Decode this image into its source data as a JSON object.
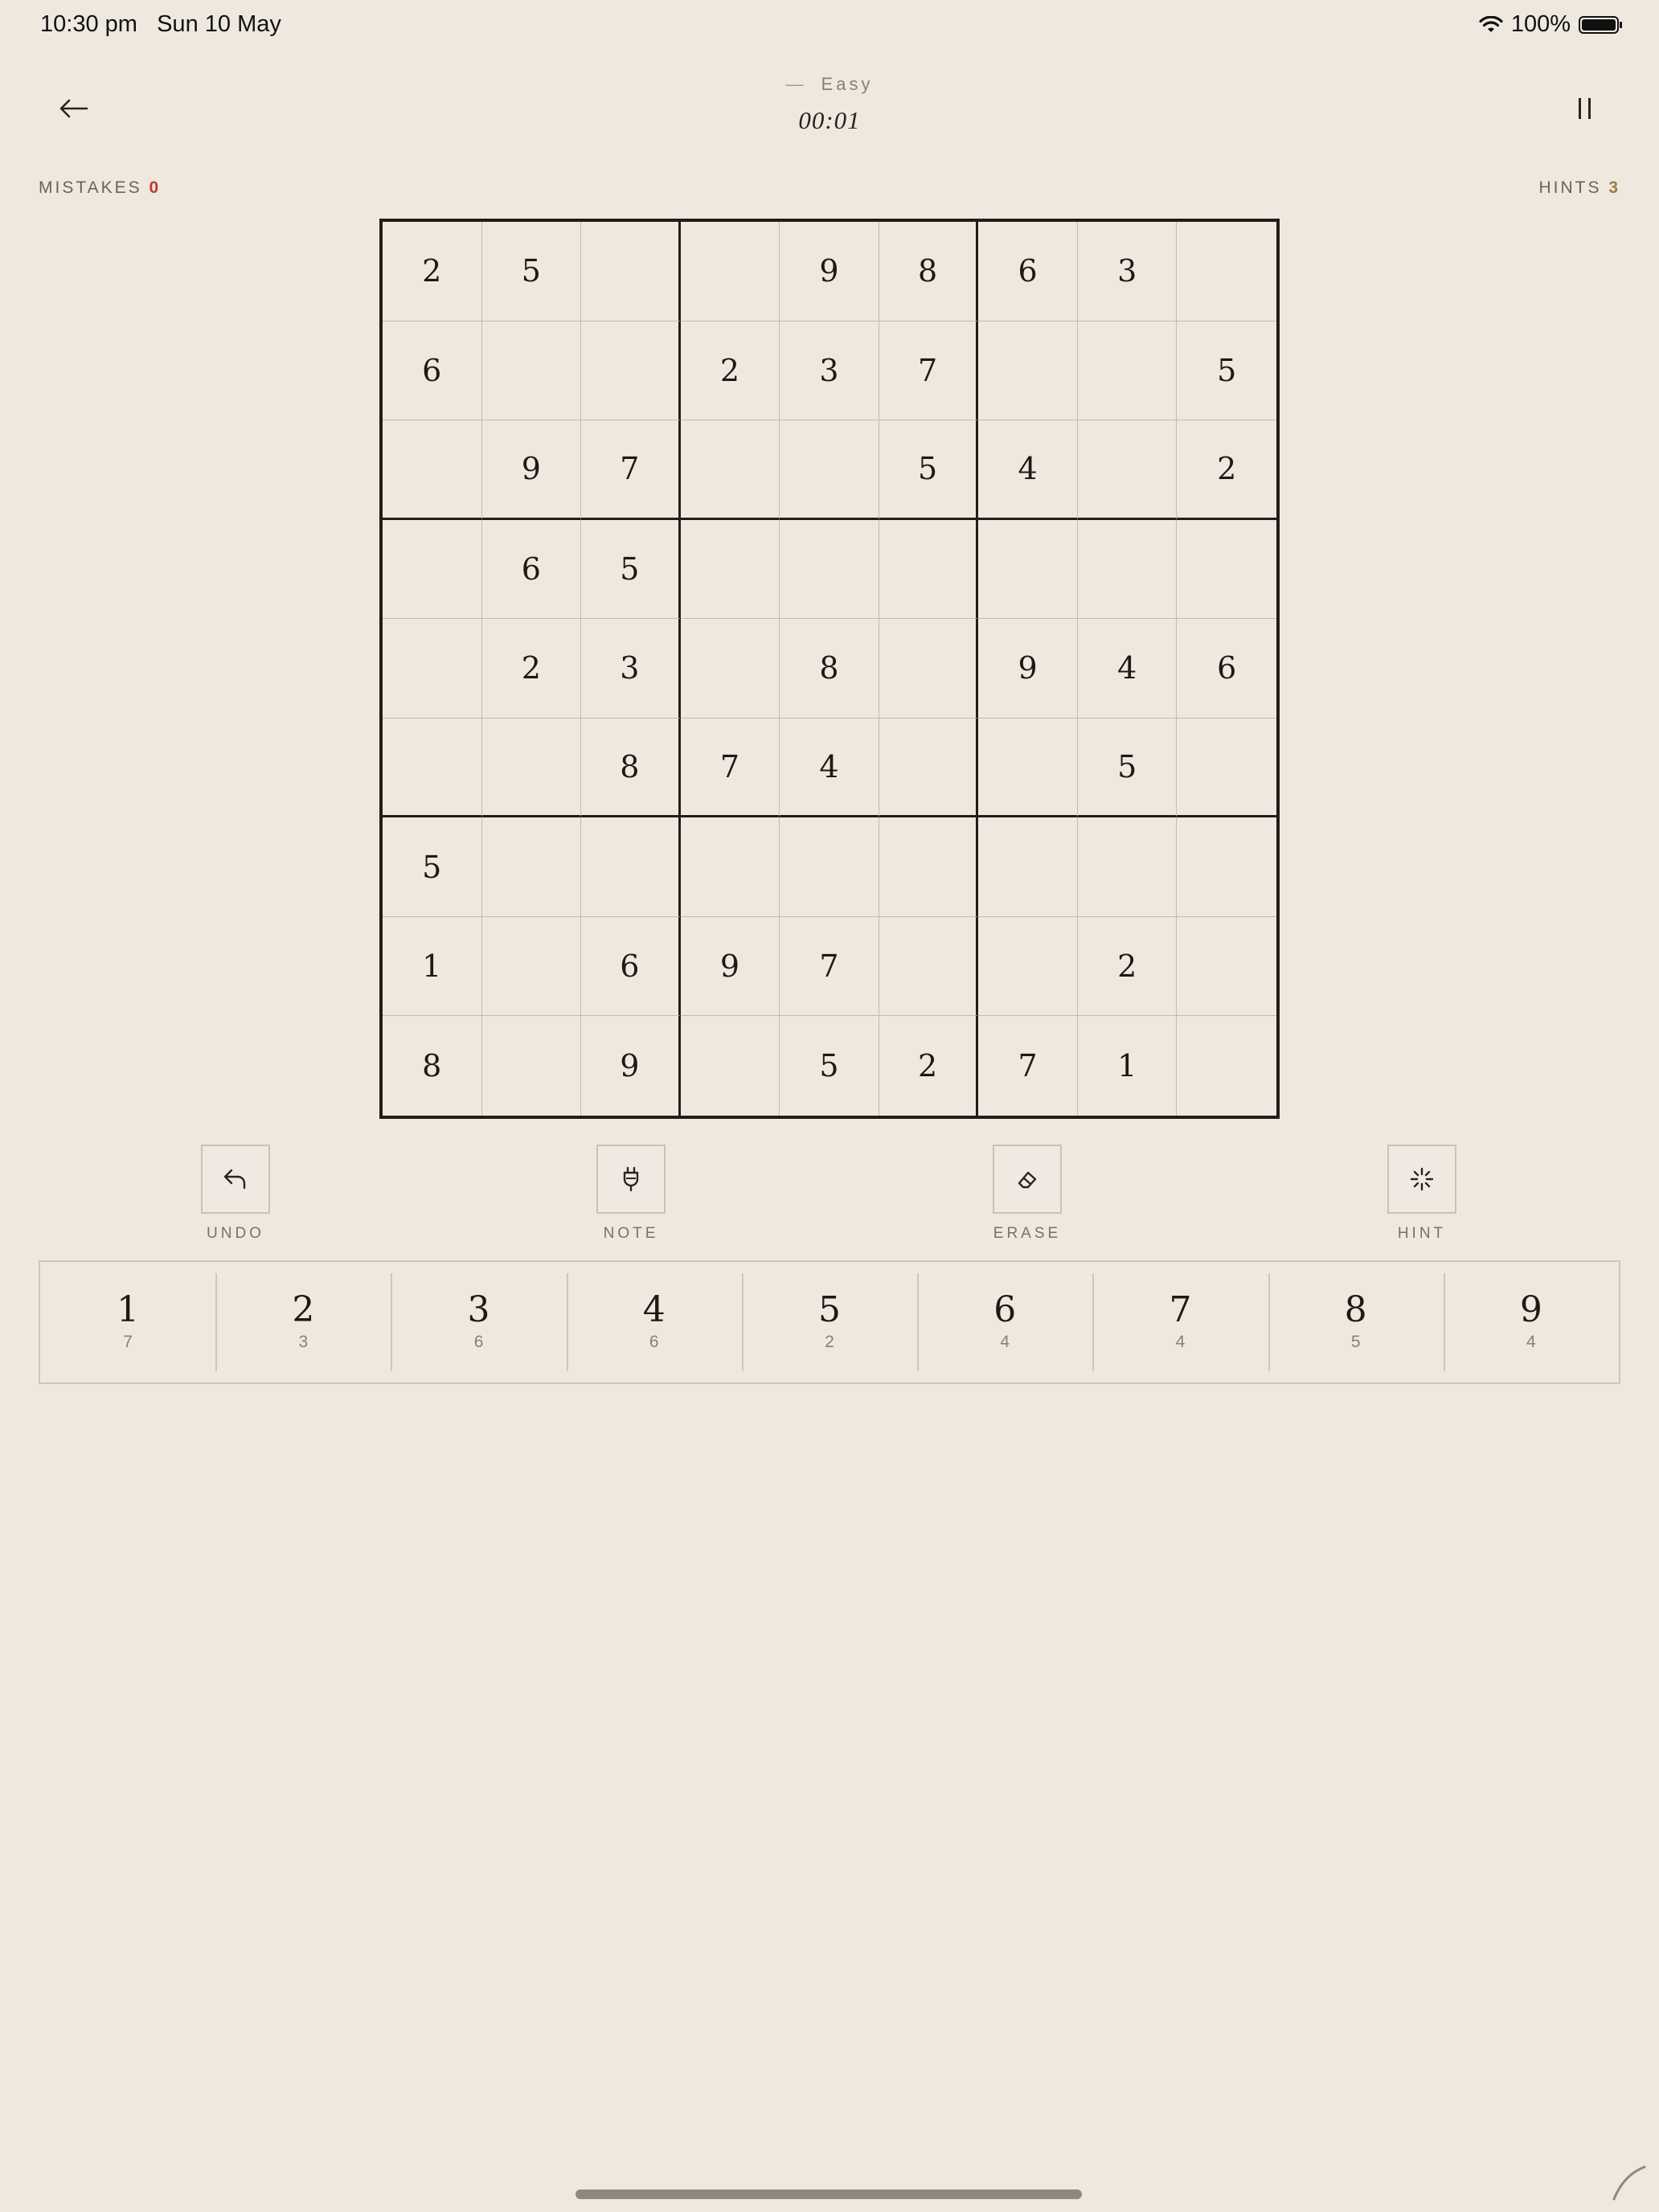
{
  "status_bar": {
    "time": "10:30 pm",
    "date": "Sun 10 May",
    "battery": "100%"
  },
  "header": {
    "dash": "—",
    "difficulty": "Easy",
    "timer": "00:01"
  },
  "stats": {
    "mistakes_label": "MISTAKES",
    "mistakes_value": "0",
    "hints_label": "HINTS",
    "hints_value": "3"
  },
  "board": [
    [
      "2",
      "5",
      "",
      "",
      "9",
      "8",
      "6",
      "3",
      ""
    ],
    [
      "6",
      "",
      "",
      "2",
      "3",
      "7",
      "",
      "",
      "5"
    ],
    [
      "",
      "9",
      "7",
      "",
      "",
      "5",
      "4",
      "",
      "2"
    ],
    [
      "",
      "6",
      "5",
      "",
      "",
      "",
      "",
      "",
      ""
    ],
    [
      "",
      "2",
      "3",
      "",
      "8",
      "",
      "9",
      "4",
      "6"
    ],
    [
      "",
      "",
      "8",
      "7",
      "4",
      "",
      "",
      "5",
      ""
    ],
    [
      "5",
      "",
      "",
      "",
      "",
      "",
      "",
      "",
      ""
    ],
    [
      "1",
      "",
      "6",
      "9",
      "7",
      "",
      "",
      "2",
      ""
    ],
    [
      "8",
      "",
      "9",
      "",
      "5",
      "2",
      "7",
      "1",
      ""
    ]
  ],
  "tools": [
    {
      "name": "undo",
      "label": "UNDO",
      "icon": "undo-icon"
    },
    {
      "name": "note",
      "label": "NOTE",
      "icon": "pen-nib-icon"
    },
    {
      "name": "erase",
      "label": "ERASE",
      "icon": "eraser-icon"
    },
    {
      "name": "hint",
      "label": "HINT",
      "icon": "sparkle-icon"
    }
  ],
  "numpad": [
    {
      "digit": "1",
      "count": "7"
    },
    {
      "digit": "2",
      "count": "3"
    },
    {
      "digit": "3",
      "count": "6"
    },
    {
      "digit": "4",
      "count": "6"
    },
    {
      "digit": "5",
      "count": "2"
    },
    {
      "digit": "6",
      "count": "4"
    },
    {
      "digit": "7",
      "count": "4"
    },
    {
      "digit": "8",
      "count": "5"
    },
    {
      "digit": "9",
      "count": "4"
    }
  ],
  "colors": {
    "background": "#efe8df",
    "mistakes": "#c23a2e",
    "hints": "#a07b3c",
    "grid_major": "#221d19",
    "grid_minor": "#c5b9ad"
  }
}
